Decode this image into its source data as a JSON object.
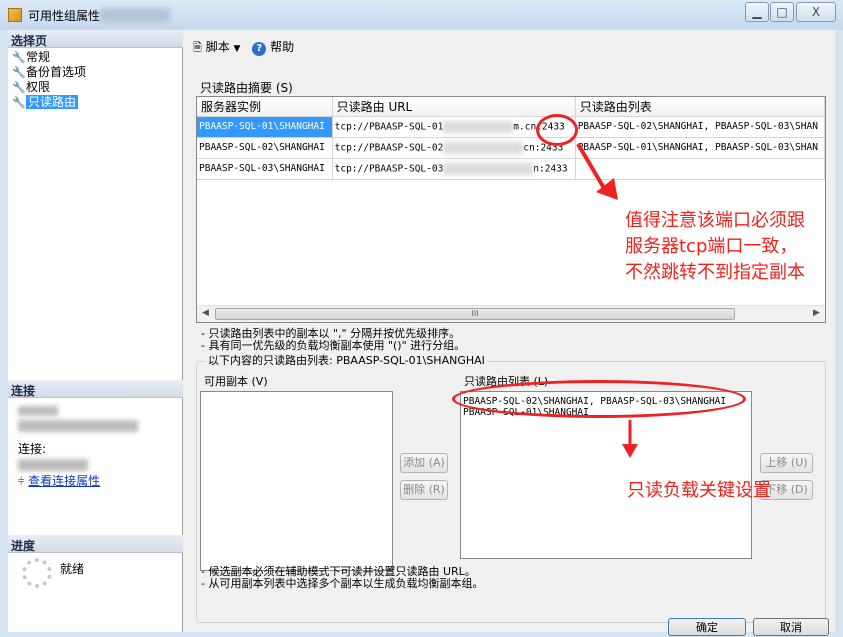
{
  "window": {
    "title": "可用性组属性",
    "minimize_glyph": "▁",
    "maximize_glyph": "□",
    "close_glyph": "X"
  },
  "left_pane": {
    "select_page_header": "选择页",
    "pages": [
      {
        "label": "常规"
      },
      {
        "label": "备份首选项"
      },
      {
        "label": "权限"
      },
      {
        "label": "只读路由"
      }
    ],
    "connection_header": "连接",
    "connection_label": "连接:",
    "view_connection_link": "查看连接属性",
    "progress_header": "进度",
    "progress_status": "就绪"
  },
  "toolbar": {
    "script_label": "脚本",
    "help_label": "帮助"
  },
  "routing_summary": {
    "label": "只读路由摘要 (S)",
    "columns": [
      "服务器实例",
      "只读路由 URL",
      "只读路由列表"
    ],
    "rows": [
      {
        "server": "PBAASP-SQL-01\\SHANGHAI",
        "url_prefix": "tcp://PBAASP-SQL-01",
        "url_suffix": "m.cn:2433",
        "list": "PBAASP-SQL-02\\SHANGHAI, PBAASP-SQL-03\\SHAN"
      },
      {
        "server": "PBAASP-SQL-02\\SHANGHAI",
        "url_prefix": "tcp://PBAASP-SQL-02",
        "url_suffix": "cn:2433",
        "list": "PBAASP-SQL-01\\SHANGHAI, PBAASP-SQL-03\\SHAN"
      },
      {
        "server": "PBAASP-SQL-03\\SHANGHAI",
        "url_prefix": "tcp://PBAASP-SQL-03",
        "url_suffix": "n:2433",
        "list": ""
      }
    ],
    "scroll_thumb_text": "III"
  },
  "notes_top": [
    "- 只读路由列表中的副本以 \",\" 分隔并按优先级排序。",
    "- 具有同一优先级的负载均衡副本使用 \"()\" 进行分组。"
  ],
  "group": {
    "caption": "以下内容的只读路由列表: PBAASP-SQL-01\\SHANGHAI",
    "available_label": "可用副本 (V)",
    "routing_list_label": "只读路由列表 (L)",
    "routing_list_items": [
      "PBAASP-SQL-02\\SHANGHAI, PBAASP-SQL-03\\SHANGHAI",
      "PBAASP-SQL-01\\SHANGHAI"
    ],
    "add_button": "添加 (A)",
    "remove_button": "删除 (R)",
    "move_up_button": "上移 (U)",
    "move_down_button": "下移 (D)"
  },
  "notes_bottom": [
    "- 候选副本必须在辅助模式下可读并设置只读路由 URL。",
    "- 从可用副本列表中选择多个副本以生成负载均衡副本组。"
  ],
  "footer": {
    "ok_button": "确定",
    "cancel_button": "取消"
  },
  "annotations": {
    "port_note_line1": "值得注意该端口必须跟",
    "port_note_line2": "服务器tcp端口一致，",
    "port_note_line3": "不然跳转不到指定副本",
    "key_setting_note": "只读负载关键设置",
    "color": "#f1211c"
  }
}
